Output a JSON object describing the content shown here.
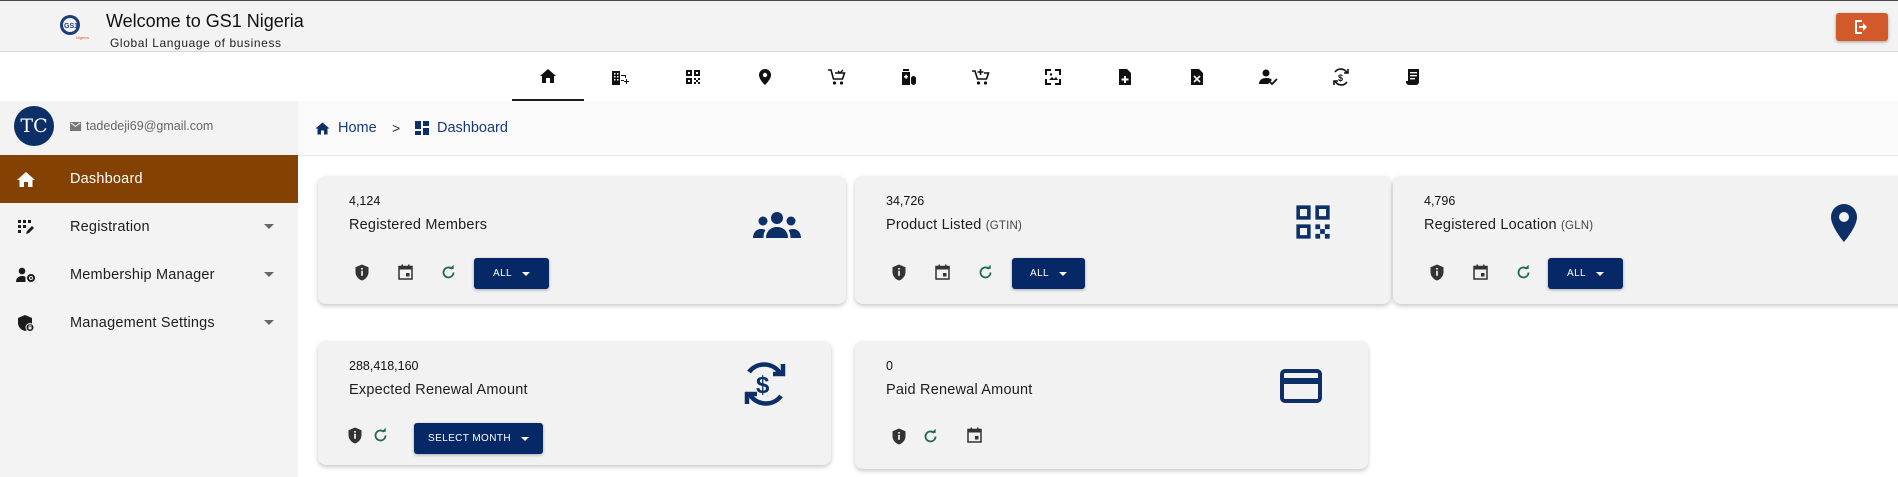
{
  "header": {
    "title": "Welcome to GS1 Nigeria",
    "subtitle": "Global Language of business",
    "logo_text": "GS1",
    "logo_sub": "Nigeria",
    "logout_icon": "logout-icon"
  },
  "topnav": {
    "items": [
      {
        "icon": "home-icon",
        "active": true
      },
      {
        "icon": "building-add-icon"
      },
      {
        "icon": "qr-code-icon"
      },
      {
        "icon": "location-pin-icon"
      },
      {
        "icon": "cart-arrow-icon"
      },
      {
        "icon": "medication-icon"
      },
      {
        "icon": "add-cart-icon"
      },
      {
        "icon": "image-frame-icon"
      },
      {
        "icon": "note-add-icon"
      },
      {
        "icon": "delete-document-icon"
      },
      {
        "icon": "person-check-icon"
      },
      {
        "icon": "currency-exchange-icon"
      },
      {
        "icon": "receipt-icon"
      }
    ]
  },
  "user": {
    "initials": "TC",
    "email": "tadedeji69@gmail.com"
  },
  "sidebar": {
    "items": [
      {
        "label": "Dashboard",
        "icon": "home-icon",
        "active": true
      },
      {
        "label": "Registration",
        "icon": "registration-icon",
        "has_caret": true
      },
      {
        "label": "Membership Manager",
        "icon": "person-gear-icon",
        "has_caret": true
      },
      {
        "label": "Management Settings",
        "icon": "shield-lock-icon",
        "has_caret": true
      }
    ]
  },
  "breadcrumb": {
    "home": "Home",
    "separator": ">",
    "current": "Dashboard"
  },
  "cards": {
    "members": {
      "value": "4,124",
      "title": "Registered Members",
      "dropdown": "ALL"
    },
    "products": {
      "value": "34,726",
      "title": "Product Listed",
      "suffix": "(GTIN)",
      "dropdown": "ALL"
    },
    "locations": {
      "value": "4,796",
      "title": "Registered Location",
      "suffix": "(GLN)",
      "dropdown": "ALL"
    },
    "renewal": {
      "value": "288,418,160",
      "title": "Expected Renewal Amount",
      "dropdown": "SELECT MONTH"
    },
    "paid": {
      "value": "0",
      "title": "Paid Renewal Amount"
    }
  },
  "colors": {
    "brand_navy": "#062866",
    "sidebar_active": "#834203",
    "logout": "#d25a2a",
    "refresh_green": "#1f6b4a"
  }
}
